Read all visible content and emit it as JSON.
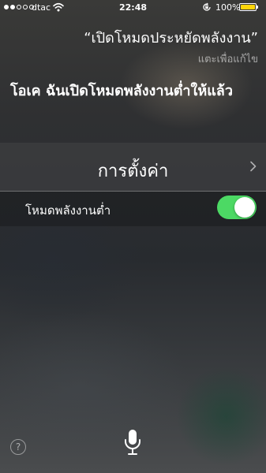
{
  "status_bar": {
    "carrier": "dtac",
    "time": "22:48",
    "battery_percent": "100%",
    "signal_dots_filled": 2,
    "signal_dots_total": 5,
    "battery_level": 1.0,
    "battery_color": "#ffd60a",
    "icons": [
      "signal-dots-icon",
      "wifi-icon",
      "orientation-lock-icon",
      "battery-icon"
    ]
  },
  "conversation": {
    "user_query": "“เปิดโหมดประหยัดพลังงาน”",
    "tap_to_edit": "แตะเพื่อแก้ไข",
    "siri_response": "โอเค ฉันเปิดโหมดพลังงานต่ำให้แล้ว"
  },
  "settings_card": {
    "header_label": "การตั้งค่า",
    "row_label": "โหมดพลังงานต่ำ",
    "toggle_on": true,
    "toggle_color": "#4cd964"
  },
  "bottom": {
    "help_label": "?",
    "mic_icon": "microphone-icon"
  }
}
